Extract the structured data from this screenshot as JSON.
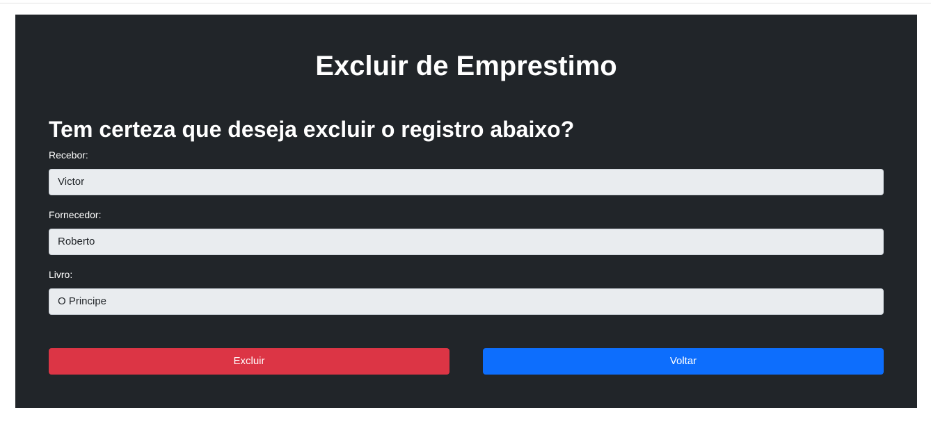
{
  "page": {
    "title": "Excluir de Emprestimo",
    "question": "Tem certeza que deseja excluir o registro abaixo?"
  },
  "fields": {
    "receiver": {
      "label": "Recebor:",
      "value": "Victor"
    },
    "supplier": {
      "label": "Fornecedor:",
      "value": "Roberto"
    },
    "book": {
      "label": "Livro:",
      "value": "O Principe"
    }
  },
  "actions": {
    "delete_label": "Excluir",
    "back_label": "Voltar"
  },
  "colors": {
    "card_background": "#212529",
    "field_background": "#e9ecef",
    "danger": "#dc3545",
    "primary": "#0d6efd"
  }
}
